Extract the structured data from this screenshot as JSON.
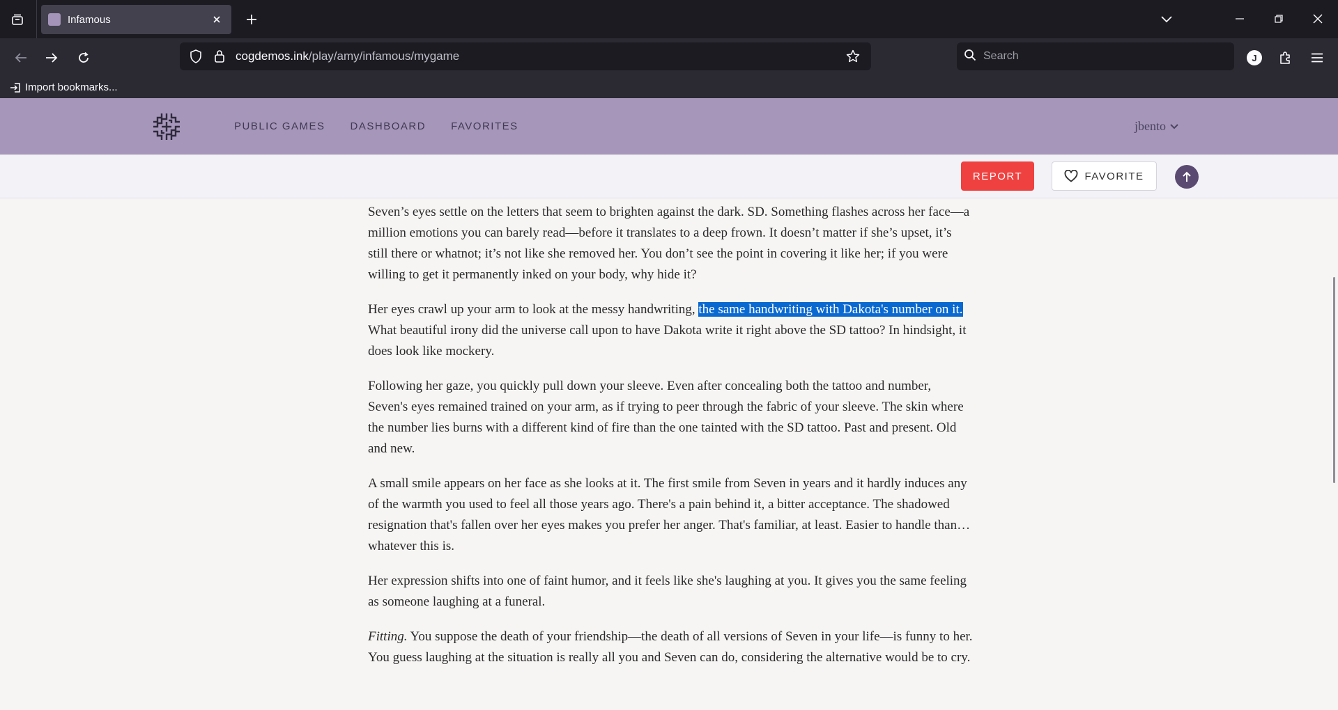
{
  "browser": {
    "tab_title": "Infamous",
    "url_host": "cogdemos.ink",
    "url_path": "/play/amy/infamous/mygame",
    "search_placeholder": "Search",
    "account_initial": "J",
    "bookmark_import": "Import bookmarks..."
  },
  "site": {
    "nav": [
      "PUBLIC GAMES",
      "DASHBOARD",
      "FAVORITES"
    ],
    "username": "jbento"
  },
  "actions": {
    "report": "REPORT",
    "favorite": "FAVORITE"
  },
  "story": {
    "p1": "Seven’s eyes settle on the letters that seem to brighten against the dark. SD. Something flashes across her face—a million emotions you can barely read—before it translates to a deep frown. It doesn’t matter if she’s upset, it’s still there or whatnot; it’s not like she removed her. You don’t see the point in covering it like her; if you were willing to get it permanently inked on your body, why hide it?",
    "p2_before": "Her eyes crawl up your arm to look at the messy handwriting, ",
    "p2_highlight": "the same handwriting with Dakota's number on it.",
    "p2_after": " What beautiful irony did the universe call upon to have Dakota write it right above the SD tattoo? In hindsight, it does look like mockery.",
    "p3": "Following her gaze, you quickly pull down your sleeve. Even after concealing both the tattoo and number, Seven's eyes remained trained on your arm, as if trying to peer through the fabric of your sleeve. The skin where the number lies burns with a different kind of fire than the one tainted with the SD tattoo. Past and present. Old and new.",
    "p4": "A small smile appears on her face as she looks at it. The first smile from Seven in years and it hardly induces any of the warmth you used to feel all those years ago. There's a pain behind it, a bitter acceptance. The shadowed resignation that's fallen over her eyes makes you prefer her anger. That's familiar, at least. Easier to handle than…whatever this is.",
    "p5": "Her expression shifts into one of faint humor, and it feels like she's laughing at you. It gives you the same feeling as someone laughing at a funeral.",
    "p6_italic": "Fitting.",
    "p6_rest": " You suppose the death of your friendship—the death of all versions of Seven in your life—is funny to her. You guess laughing at the situation is really all you and Seven can do, considering the alternative would be to cry."
  },
  "colors": {
    "header_purple": "#a696ba",
    "report_red": "#ef4140",
    "highlight_blue": "#0a69d0"
  }
}
